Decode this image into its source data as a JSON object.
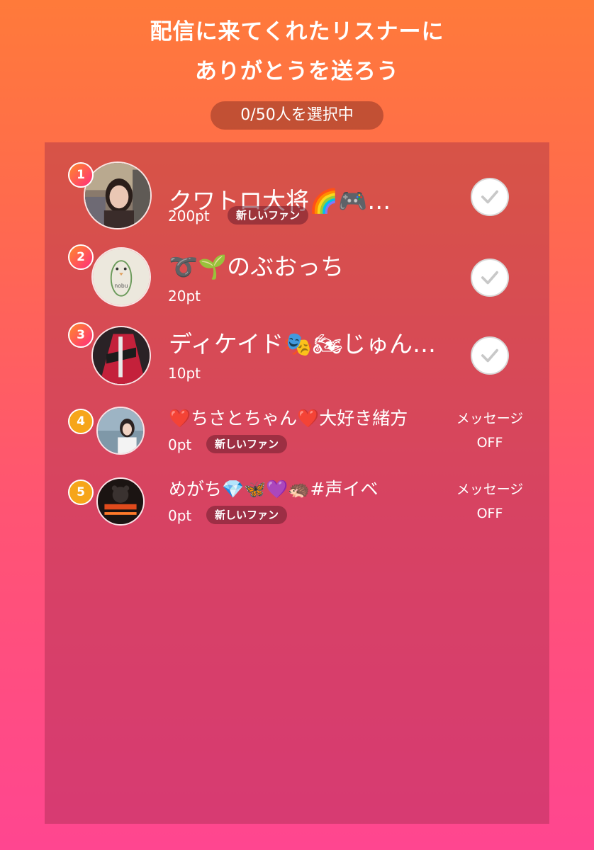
{
  "header": {
    "title_line1": "配信に来てくれたリスナーに",
    "title_line2": "ありがとうを送ろう",
    "selection_counter": "0/50人を選択中"
  },
  "colors": {
    "background_top": "#ff7a3a",
    "background_bottom": "#ff4690",
    "rank_top3_gradient": [
      "#ff8a2a",
      "#ff2d7d"
    ],
    "rank_other": "#f6a51a",
    "check_icon": "#c8c8c8"
  },
  "listeners": [
    {
      "rank": "1",
      "name": "クワトロ大将🌈🎮",
      "ellipsis": "…",
      "points": "200pt",
      "badge": "新しいファン",
      "action": "check",
      "avatar_icon": "user-photo-woman-icon"
    },
    {
      "rank": "2",
      "name": "➰🌱のぶおっち",
      "ellipsis": "",
      "points": "20pt",
      "badge": "",
      "action": "check",
      "avatar_icon": "bird-drawing-icon"
    },
    {
      "rank": "3",
      "name": "ディケイド🎭🏍じゅん",
      "ellipsis": "…",
      "points": "10pt",
      "badge": "",
      "action": "check",
      "avatar_icon": "hero-mask-icon"
    },
    {
      "rank": "4",
      "name": "❤️ちさとちゃん❤️大好き緒方",
      "ellipsis": "",
      "points": "0pt",
      "badge": "新しいファン",
      "action": "message_off",
      "message_label": "メッセージ",
      "message_state": "OFF",
      "avatar_icon": "user-photo-sea-icon"
    },
    {
      "rank": "5",
      "name": "めがち💎🦋💜🦔#声イベ",
      "ellipsis": "",
      "points": "0pt",
      "badge": "新しいファン",
      "action": "message_off",
      "message_label": "メッセージ",
      "message_state": "OFF",
      "avatar_icon": "dark-bear-icon"
    }
  ]
}
